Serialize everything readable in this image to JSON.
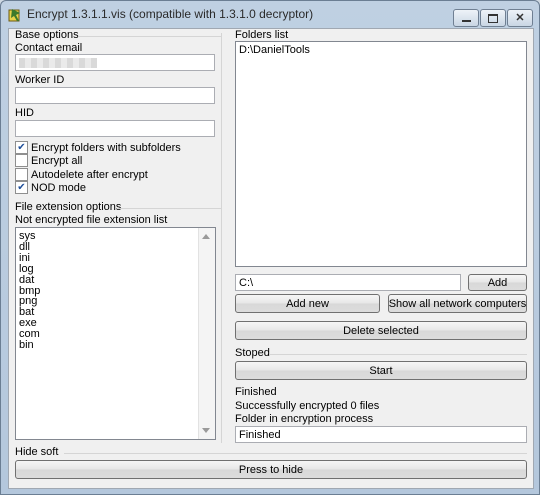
{
  "window": {
    "title": "Encrypt 1.3.1.1.vis (compatible with 1.3.1.0 decryptor)"
  },
  "base_options": {
    "group_label": "Base options",
    "contact_email_label": "Contact email",
    "contact_email_value": "",
    "worker_id_label": "Worker ID",
    "worker_id_value": "",
    "hid_label": "HID",
    "hid_value": "",
    "checkboxes": [
      {
        "label": "Encrypt folders with subfolders",
        "checked": true
      },
      {
        "label": "Encrypt all",
        "checked": false
      },
      {
        "label": "Autodelete after encrypt",
        "checked": false
      },
      {
        "label": "NOD mode",
        "checked": true
      }
    ]
  },
  "file_extension_options": {
    "group_label": "File extension options",
    "list_label": "Not encrypted file extension list",
    "extensions": [
      "sys",
      "dll",
      "ini",
      "log",
      "dat",
      "bmp",
      "png",
      "bat",
      "exe",
      "com",
      "bin"
    ]
  },
  "folders": {
    "group_label": "Folders list",
    "items": [
      "D:\\DanielTools"
    ],
    "path_value": "C:\\",
    "add_label": "Add",
    "add_new_label": "Add new",
    "show_network_label": "Show all network computers",
    "delete_selected_label": "Delete selected"
  },
  "status": {
    "group_label": "Stoped",
    "start_label": "Start",
    "line1": "Finished",
    "line2": "Successfully encrypted 0 files",
    "line3": "Folder in encryption process",
    "current_value": "Finished"
  },
  "hide": {
    "group_label": "Hide soft",
    "button_label": "Press to hide"
  },
  "colors": {
    "title_bar": "#bfd0e2",
    "client_bg": "#f0f0f0",
    "check_mark": "#1f4f9a"
  }
}
